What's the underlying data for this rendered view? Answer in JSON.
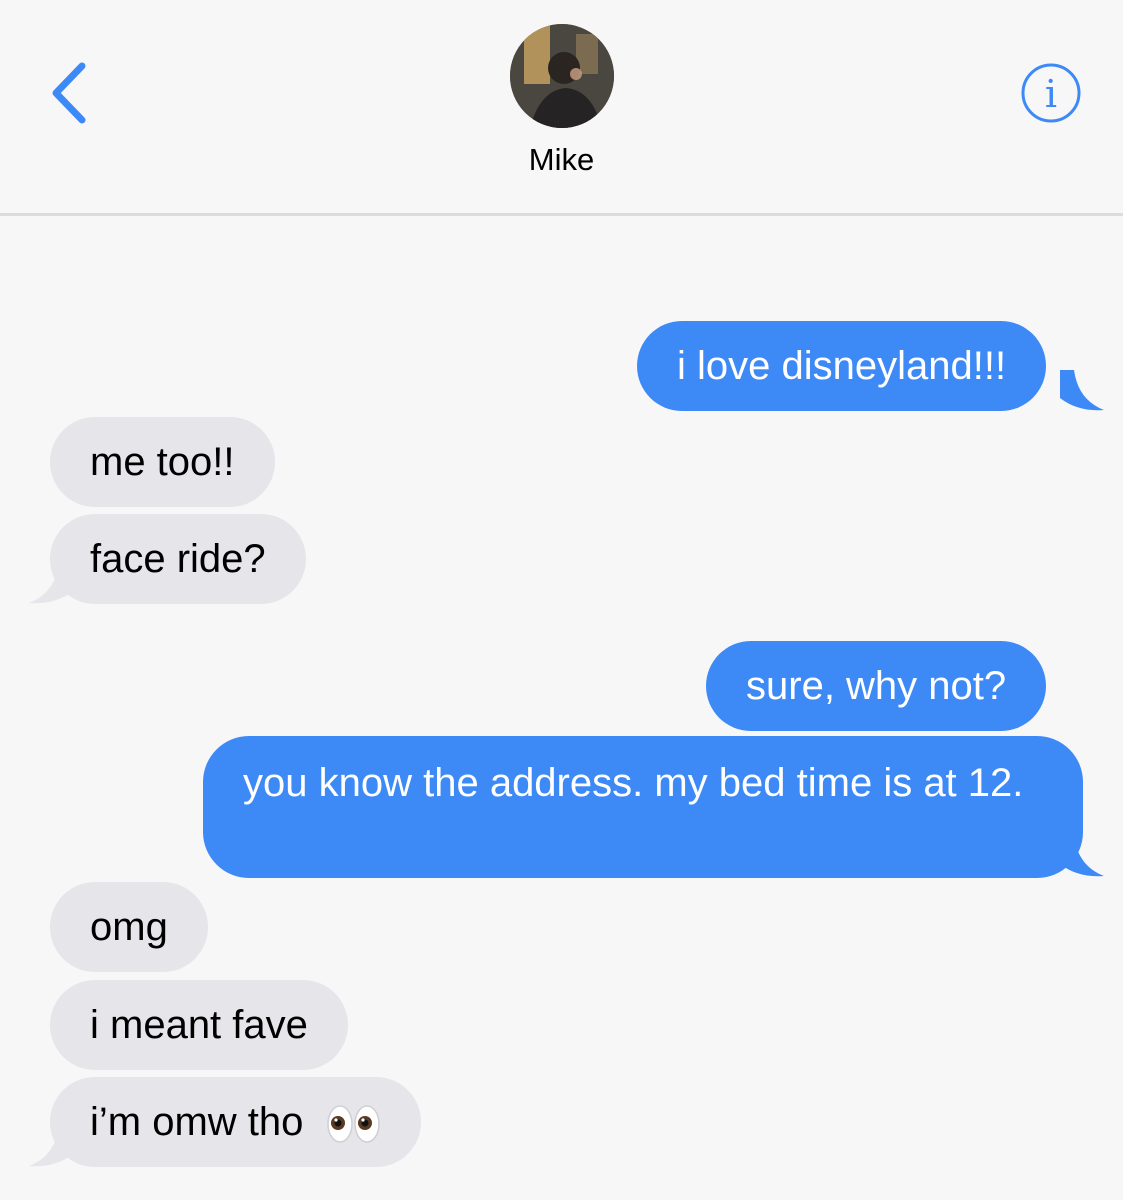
{
  "header": {
    "contact_name": "Mike",
    "back_icon": "chevron-left-icon",
    "info_icon": "info-circle-icon",
    "accent_color": "#3d8af7"
  },
  "messages": [
    {
      "direction": "sent",
      "text": "i love disneyland!!!"
    },
    {
      "direction": "received",
      "text": "me too!!"
    },
    {
      "direction": "received",
      "text": "face ride?"
    },
    {
      "direction": "sent",
      "text": "sure, why not?"
    },
    {
      "direction": "sent",
      "text": "you know the address. my bed time is at 12."
    },
    {
      "direction": "received",
      "text": "omg"
    },
    {
      "direction": "received",
      "text": "i meant fave"
    },
    {
      "direction": "received",
      "text": "i’m omw tho",
      "emoji": "eyes-emoji-icon"
    }
  ]
}
